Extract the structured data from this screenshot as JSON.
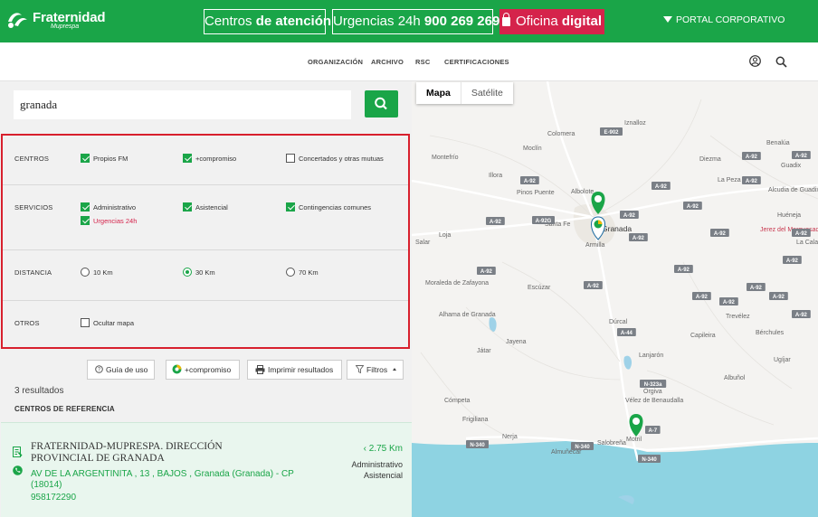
{
  "header": {
    "logo": {
      "name": "Fraternidad",
      "sub": "Muprespa"
    },
    "centros": {
      "pre": "Centros ",
      "bold": "de atención"
    },
    "urgencias": {
      "pre": "Urgencias 24h ",
      "bold": "900 269 269"
    },
    "oficina": {
      "pre": "Oficina ",
      "bold": "digital"
    },
    "portal": "PORTAL CORPORATIVO"
  },
  "nav": {
    "items": [
      "ORGANIZACIÓN",
      "ARCHIVO",
      "RSC",
      "CERTIFICACIONES"
    ]
  },
  "search": {
    "value": "granada"
  },
  "filters": {
    "centros": {
      "label": "CENTROS",
      "opts": [
        "Propios FM",
        "+compromiso",
        "Concertados y otras mutuas"
      ]
    },
    "servicios": {
      "label": "SERVICIOS",
      "opts": [
        "Administrativo",
        "Asistencial",
        "Contingencias comunes",
        "Urgencias 24h"
      ]
    },
    "distancia": {
      "label": "DISTANCIA",
      "opts": [
        "10 Km",
        "30 Km",
        "70 Km"
      ]
    },
    "otros": {
      "label": "OTROS",
      "opts": [
        "Ocultar mapa"
      ]
    }
  },
  "tools": {
    "guia": "Guía de uso",
    "compromiso": "+compromiso",
    "imprimir": "Imprimir resultados",
    "filtros": "Filtros"
  },
  "results": {
    "count": "3 resultados",
    "section": "CENTROS DE REFERENCIA"
  },
  "card": {
    "name": "FRATERNIDAD-MUPRESPA. DIRECCIÓN PROVINCIAL DE GRANADA",
    "address": "AV DE LA ARGENTINITA , 13 , BAJOS , Granada (Granada) - CP (18014)",
    "phone": "958172290",
    "distance": "‹ 2.75 Km",
    "services": [
      "Administrativo",
      "Asistencial"
    ]
  },
  "map": {
    "tabs": [
      "Mapa",
      "Satélite"
    ],
    "places": [
      {
        "t": "Iznalloz"
      },
      {
        "t": "Colomera"
      },
      {
        "t": "Montefrío"
      },
      {
        "t": "Moclín"
      },
      {
        "t": "Illora"
      },
      {
        "t": "Pinos Puente"
      },
      {
        "t": "Albolote"
      },
      {
        "t": "Santa Fe"
      },
      {
        "t": "Armilla"
      },
      {
        "t": "Granada"
      },
      {
        "t": "Loja"
      },
      {
        "t": "Salar"
      },
      {
        "t": "Moraleda de Zafayona"
      },
      {
        "t": "Escúzar"
      },
      {
        "t": "Alhama de Granada"
      },
      {
        "t": "Játar"
      },
      {
        "t": "Jayena"
      },
      {
        "t": "Dúrcal"
      },
      {
        "t": "Lanjarón"
      },
      {
        "t": "Órgiva"
      },
      {
        "t": "Vélez de Benaudalla"
      },
      {
        "t": "Motril"
      },
      {
        "t": "Salobreña"
      },
      {
        "t": "Almuñécar"
      },
      {
        "t": "Cómpeta"
      },
      {
        "t": "Frigiliana"
      },
      {
        "t": "Nerja"
      },
      {
        "t": "Trevélez"
      },
      {
        "t": "Bérchules"
      },
      {
        "t": "Capileira"
      },
      {
        "t": "Guadix"
      },
      {
        "t": "Diezma"
      },
      {
        "t": "La Peza"
      },
      {
        "t": "Alcudia de Guadix"
      },
      {
        "t": "Huéneja"
      },
      {
        "t": "La Calahorra"
      },
      {
        "t": "Jerez del Marquesado"
      },
      {
        "t": "Benalúa"
      },
      {
        "t": "Ugíjar"
      },
      {
        "t": "Albuñol"
      }
    ],
    "roads": [
      "E-902",
      "A-92",
      "A-92",
      "A-92",
      "A-92G",
      "A-92",
      "A-44",
      "N-323a",
      "A-7",
      "N-340",
      "N-340",
      "N-340",
      "A-92",
      "A-92",
      "A-92",
      "A-92",
      "A-92",
      "A-92",
      "A-92",
      "A-92",
      "A-92",
      "A-92",
      "A-92",
      "A-92",
      "A-92",
      "A-92",
      "A-92",
      "A-92",
      "A-92",
      "A-92"
    ]
  }
}
